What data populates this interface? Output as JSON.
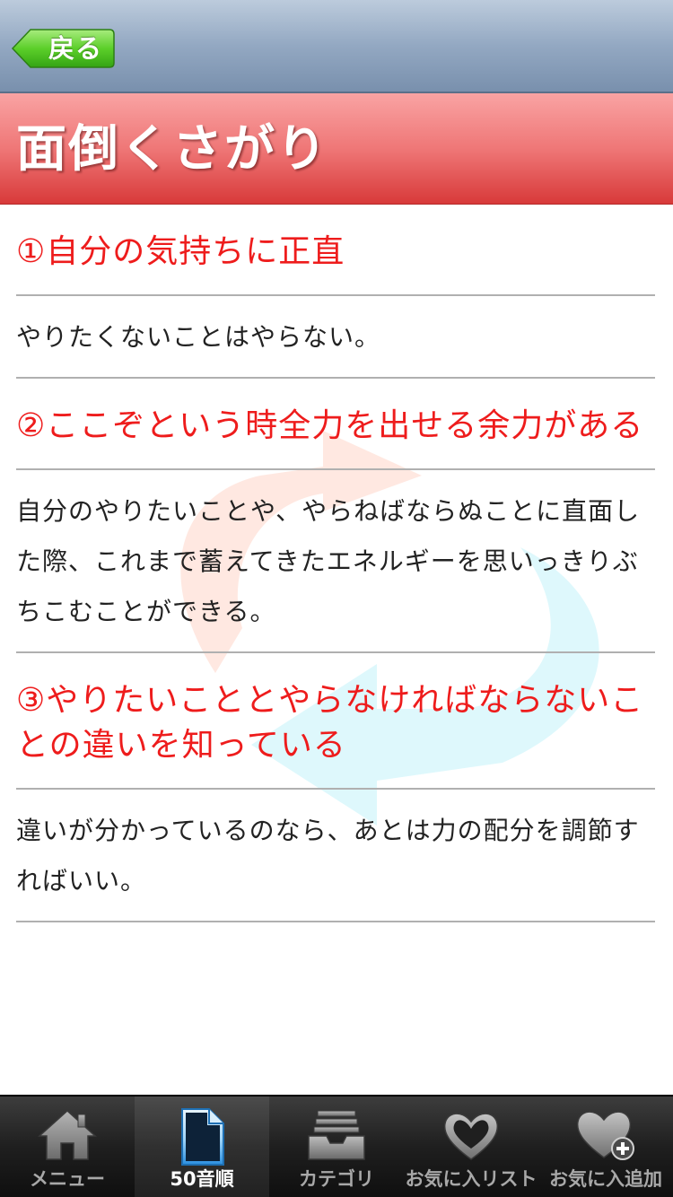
{
  "nav": {
    "back_label": "戻る"
  },
  "title": "面倒くさがり",
  "sections": [
    {
      "heading": "①自分の気持ちに正直",
      "body": "やりたくないことはやらない。"
    },
    {
      "heading": "②ここぞという時全力を出せる余力がある",
      "body": "自分のやりたいことや、やらねばならぬことに直面した際、これまで蓄えてきたエネルギーを思いっきりぶちこむことができる。"
    },
    {
      "heading": "③やりたいこととやらなければならないことの違いを知っている",
      "body": "違いが分かっているのなら、あとは力の配分を調節すればいい。"
    }
  ],
  "tabs": [
    {
      "label": "メニュー",
      "icon": "home-icon"
    },
    {
      "label": "50音順",
      "icon": "document-icon"
    },
    {
      "label": "カテゴリ",
      "icon": "inbox-tray-icon"
    },
    {
      "label": "お気に入リスト",
      "icon": "heart-outline-icon"
    },
    {
      "label": "お気に入追加",
      "icon": "heart-plus-icon"
    }
  ],
  "active_tab": 1,
  "colors": {
    "heading_red": "#ee1c1c",
    "title_band": "#ef7777",
    "back_button_green": "#4cc21f"
  }
}
